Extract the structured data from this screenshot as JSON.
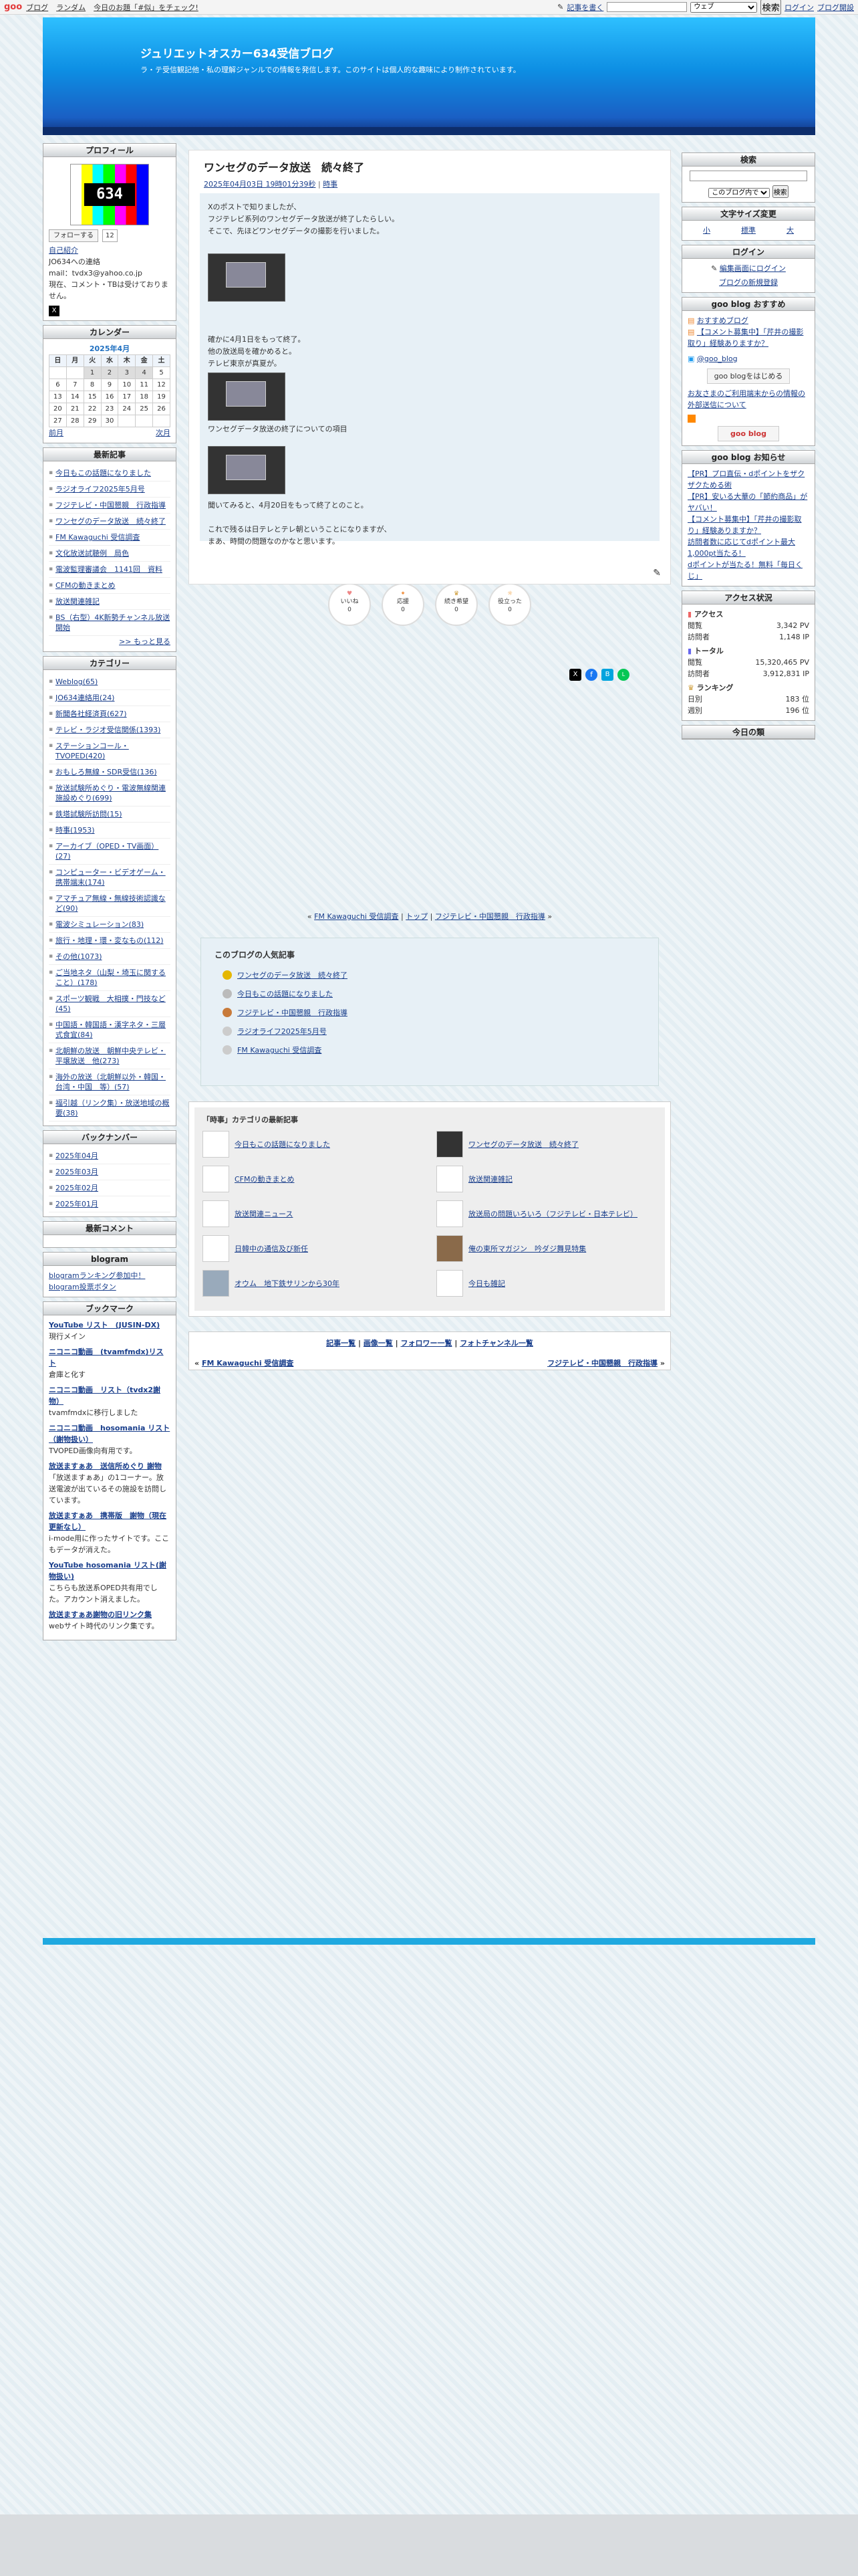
{
  "topbar": {
    "logo": "goo",
    "links": [
      "ブログ",
      "ランダム",
      "今日のお題「#似」をチェック!"
    ],
    "write": "記事を書く",
    "search_scope": "ウェブ",
    "search_btn": "検索",
    "login": "ログイン",
    "blog_open": "ブログ開設"
  },
  "header": {
    "title": "ジュリエットオスカー634受信ブログ",
    "description": "ラ・テ受信観記他・私の理解ジャンルでの情報を発信します。このサイトは個人的な趣味により制作されています。"
  },
  "profile": {
    "heading": "プロフィール",
    "follow": "フォローする",
    "follow_count": "12",
    "self_intro": "自己紹介",
    "lines": [
      "JO634への連絡",
      "mail：tvdx3@yahoo.co.jp",
      "現在、コメント・TBは受けておりません。"
    ],
    "x_label": "X"
  },
  "calendar": {
    "heading": "カレンダー",
    "month": "2025年4月",
    "days": [
      "日",
      "月",
      "火",
      "水",
      "木",
      "金",
      "土"
    ],
    "rows": [
      [
        "",
        "",
        "1",
        "2",
        "3",
        "4",
        "5"
      ],
      [
        "6",
        "7",
        "8",
        "9",
        "10",
        "11",
        "12"
      ],
      [
        "13",
        "14",
        "15",
        "16",
        "17",
        "18",
        "19"
      ],
      [
        "20",
        "21",
        "22",
        "23",
        "24",
        "25",
        "26"
      ],
      [
        "27",
        "28",
        "29",
        "30",
        "",
        "",
        ""
      ]
    ],
    "prev": "前月",
    "next": "次月"
  },
  "latest": {
    "heading": "最新記事",
    "items": [
      "今日もこの話題になりました",
      "ラジオライフ2025年5月号",
      "フジテレビ・中国懇親　行政指導",
      "ワンセグのデータ放送　続々終了",
      "FM Kawaguchi 受信調査",
      "文化放送試聴例　局色",
      "電波監理審議会　1141回　資料",
      "CFMの動きまとめ",
      "放送関連雑記",
      "BS（右型）4K新勢チャンネル放送開始"
    ],
    "more": ">> もっと見る"
  },
  "categories": {
    "heading": "カテゴリー",
    "items": [
      "Weblog(65)",
      "JO634連絡用(24)",
      "新聞各社経済頁(627)",
      "テレビ・ラジオ受信関係(1393)",
      "ステーションコール・TVOPED(420)",
      "おもしろ無線・SDR受信(136)",
      "放送試験所めぐり・電波無線関連施設めぐり(699)",
      "鉄塔試験所訪問(15)",
      "時事(1953)",
      "アーカイブ（OPED・TV画面）(27)",
      "コンピューター・ビデオゲーム・携帯端末(174)",
      "アマチュア無線・無線技術認識など(90)",
      "電波シミュレーション(83)",
      "旅行・地理・環・変なもの(112)",
      "その他(1073)",
      "ご当地ネタ（山梨・埼玉に関すること）(178)",
      "スポーツ観戦　大相撲・門技など(45)",
      "中国語・韓国語・漢字ネタ・三層式食宜(84)",
      "北朝鮮の放送　朝鮮中央テレビ・平壌放送　他(273)",
      "海外の放送（北朝鮮以外・韓国・台湾・中国　等）(57)",
      "福引越（リンク集）・放送地域の概要(38)"
    ]
  },
  "backnumber": {
    "heading": "バックナンバー",
    "items": [
      "2025年04月",
      "2025年03月",
      "2025年02月",
      "2025年01月"
    ]
  },
  "comments": {
    "heading": "最新コメント"
  },
  "blogram": {
    "heading": "blogram",
    "link": "blogramランキング参加中！",
    "btn": "blogram投票ボタン"
  },
  "bookmark": {
    "heading": "ブックマーク",
    "items": [
      {
        "t": "YouTube リスト　(JUSIN-DX)",
        "d": "現行メイン"
      },
      {
        "t": "ニコニコ動画　(tvamfmdx)リスト",
        "d": "倉庫と化す"
      },
      {
        "t": "ニコニコ動画　リスト（tvdx2謝物）",
        "d": "tvamfmdxに移行しました"
      },
      {
        "t": "ニコニコ動画　hosomania リスト（謝物扱い）",
        "d": "TVOPED画像向有用です。"
      },
      {
        "t": "放送ますぁあ　送信所めぐり 謝物",
        "d": "「放送ますぁあ」の1コーナー。放送電波が出ているその施設を訪問しています。"
      },
      {
        "t": "放送ますぁあ　携帯版　謝物（現在更新なし）",
        "d": "i-mode用に作ったサイトです。ここもデータが消えた。"
      },
      {
        "t": "YouTube hosomania リスト(謝物扱い)",
        "d": "こちらも放送系OPED共有用でした。アカウント消えました。"
      },
      {
        "t": "放送ますぁあ謝物の旧リンク集",
        "d": "webサイト時代のリンク集です。"
      }
    ]
  },
  "entry": {
    "title": "ワンセグのデータ放送　続々終了",
    "date": "2025年04月03日 19時01分39秒",
    "cat": "時事",
    "p1": [
      "Xのポストで知りましたが、",
      "フジテレビ系列のワンセグデータ放送が終了したらしい。",
      "そこで、先ほどワンセグデータの撮影を行いました。"
    ],
    "p2": [
      "確かに4月1日をもって終了。",
      "他の放送局を確かめると。",
      "テレビ東京が真夏が。"
    ],
    "cap2": "ワンセグデータ放送の終了についての項目",
    "p3": [
      "聞いてみると、4月20日をもって終了とのこと。",
      "",
      "これで残るは日テレとテレ朝ということになりますが、",
      "まあ、時間の問題なのかなと思います。"
    ]
  },
  "reactions": [
    {
      "l": "いいね",
      "n": "0"
    },
    {
      "l": "応援",
      "n": "0"
    },
    {
      "l": "続き希望",
      "n": "0"
    },
    {
      "l": "役立った",
      "n": "0"
    }
  ],
  "pager": {
    "prev": "FM Kawaguchi 受信調査",
    "top": "トップ",
    "next": "フジテレビ・中国懇親　行政指導"
  },
  "popular": {
    "heading": "このブログの人気記事",
    "items": [
      "ワンセグのデータ放送　続々終了",
      "今日もこの話題になりました",
      "フジテレビ・中国懇親　行政指導",
      "ラジオライフ2025年5月号",
      "FM Kawaguchi 受信調査"
    ]
  },
  "recent": {
    "heading": "「時事」カテゴリの最新記事",
    "items": [
      "今日もこの話題になりました",
      "ワンセグのデータ放送　続々終了",
      "CFMの動きまとめ",
      "放送関連雑記",
      "放送関連ニュース",
      "放送局の問題いろいろ（フジテレビ・日本テレビ）",
      "日韓中の通信及び新任",
      "俺の東所マガジン　吟ダジ舞見特集",
      "オウム　地下鉄サリンから30年",
      "今日も雑記"
    ]
  },
  "bottomnav": {
    "links": [
      "記事一覧",
      "画像一覧",
      "フォロワー一覧",
      "フォトチャンネル一覧"
    ],
    "prev": "FM Kawaguchi 受信調査",
    "next": "フジテレビ・中国懇親　行政指導"
  },
  "search": {
    "heading": "検索",
    "scope": "このブログ内で",
    "btn": "検索"
  },
  "fontsize": {
    "heading": "文字サイズ変更",
    "small": "小",
    "normal": "標準",
    "large": "大"
  },
  "login": {
    "heading": "ログイン",
    "edit": "編集画面にログイン",
    "make": "ブログの新規登録"
  },
  "goorec": {
    "heading": "goo blog おすすめ",
    "items": [
      "おすすめブログ",
      "【コメント募集中】「芹井の撮影取り」経験ありますか？",
      "@goo_blog",
      "goo blogをはじめる",
      "お友さまのご利用端末からの情報の外部送信について",
      "goo blog"
    ]
  },
  "notice": {
    "heading": "goo blog お知らせ",
    "items": [
      "【PR】プロ直伝・dポイントをザクザクためる術",
      "【PR】安いる大華の「節約商品」がヤバい！",
      "【コメント募集中】「芹井の撮影取り」経験ありますか？",
      "訪問者数に応じてdポイント最大1,000pt当たる！",
      "dポイントが当たる！無料「毎日くじ」"
    ]
  },
  "access": {
    "heading": "アクセス状況",
    "access": "アクセス",
    "pv_l": "閲覧",
    "pv": "3,342 PV",
    "ip_l": "訪問者",
    "ip": "1,148 IP",
    "total": "トータル",
    "tpv": "15,320,465 PV",
    "tip": "3,912,831 IP",
    "rank": "ランキング",
    "day_l": "日別",
    "day": "183 位",
    "week_l": "週別",
    "week": "196 位"
  },
  "todaylog": {
    "heading": "今日の類"
  },
  "colors": {
    "header_top": "#2ec0ff",
    "header_bottom": "#10317a",
    "accent": "#1fa9e0"
  }
}
